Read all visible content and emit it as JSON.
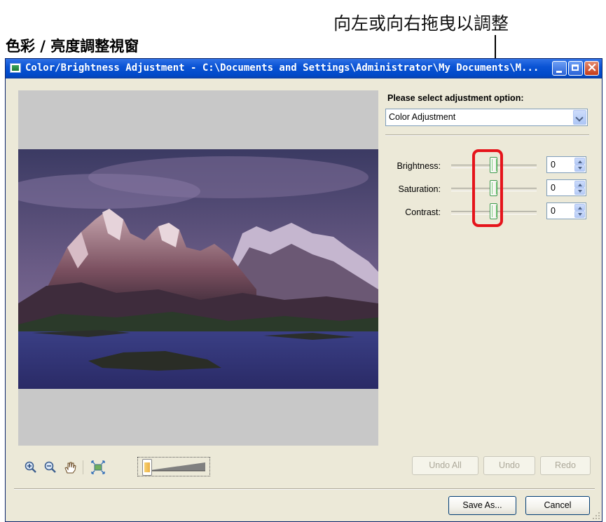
{
  "annotation": {
    "callout_text": "向左或向右拖曳以調整",
    "section_title": "色彩 / 亮度調整視窗",
    "highlight_color": "#e5141b"
  },
  "window": {
    "title": "Color/Brightness Adjustment - C:\\Documents and Settings\\Administrator\\My Documents\\M...",
    "icon": "app-icon",
    "controls": [
      "minimize",
      "maximize",
      "close"
    ]
  },
  "preview_toolbar": {
    "tools": [
      "zoom-in-icon",
      "zoom-out-icon",
      "hand-icon",
      "fit-to-window-icon"
    ],
    "zoom_slider_value": 0.0
  },
  "adjustment": {
    "option_label": "Please select adjustment option:",
    "selected_option": "Color Adjustment",
    "rows": [
      {
        "label": "Brightness:",
        "value": "0",
        "position": 0.5
      },
      {
        "label": "Saturation:",
        "value": "0",
        "position": 0.5
      },
      {
        "label": "Contrast:",
        "value": "0",
        "position": 0.5
      }
    ]
  },
  "buttons": {
    "undo_all": "Undo All",
    "undo": "Undo",
    "redo": "Redo",
    "save_as": "Save As...",
    "cancel": "Cancel"
  }
}
